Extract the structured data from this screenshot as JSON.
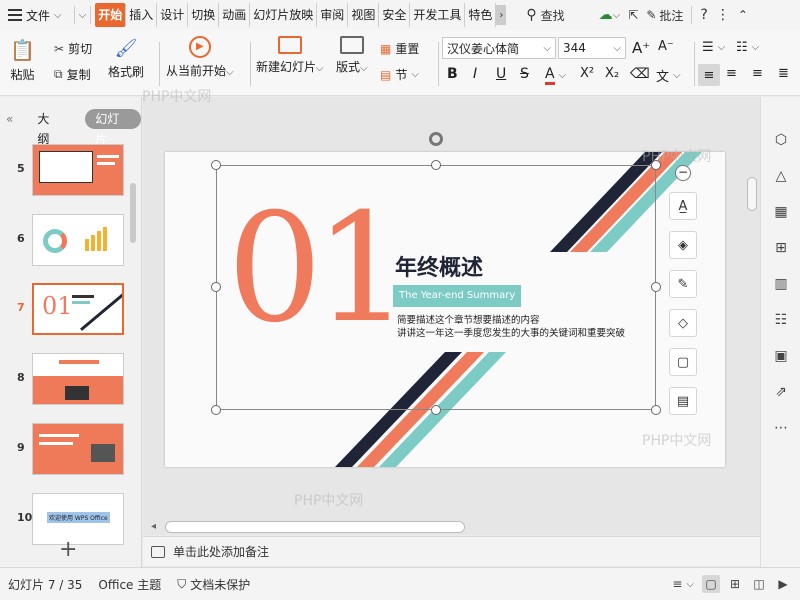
{
  "menu": {
    "file": "文件"
  },
  "tabs": [
    "开始",
    "插入",
    "设计",
    "切换",
    "动画",
    "幻灯片放映",
    "审阅",
    "视图",
    "安全",
    "开发工具",
    "特色"
  ],
  "topright": {
    "search": "查找",
    "comment": "批注"
  },
  "ribbon": {
    "paste": "粘贴",
    "cut": "剪切",
    "copy": "复制",
    "format_painter": "格式刷",
    "from_current": "从当前开始",
    "new_slide": "新建幻灯片",
    "layout": "版式",
    "reset": "重置",
    "section": "节",
    "font_name": "汉仪姜心体简",
    "font_size": "344"
  },
  "panel": {
    "outline_tab": "大纲",
    "slides_tab": "幻灯片",
    "slide_numbers": [
      "5",
      "6",
      "7",
      "8",
      "9",
      "10"
    ],
    "selected_index": 2
  },
  "slide": {
    "number_text": "01",
    "title": "年终概述",
    "subtitle_en": "The Year-end Summary",
    "desc_line1": "简要描述这个章节想要描述的内容",
    "desc_line2": "讲讲这一年这一季度您发生的大事的关键词和重要突破",
    "thumb10_text": "欢迎使用 WPS Office"
  },
  "notes": {
    "placeholder": "单击此处添加备注"
  },
  "status": {
    "slide_counter": "幻灯片 7 / 35",
    "theme": "Office 主题",
    "protection": "文档未保护"
  },
  "watermarks": [
    "PHP中文网",
    "PHP中文网",
    "PHP中文网",
    "PHP中文网"
  ],
  "colors": {
    "accent": "#e8682f",
    "coral": "#f07a5c",
    "teal": "#7ccbc4",
    "navy": "#1f2436"
  }
}
